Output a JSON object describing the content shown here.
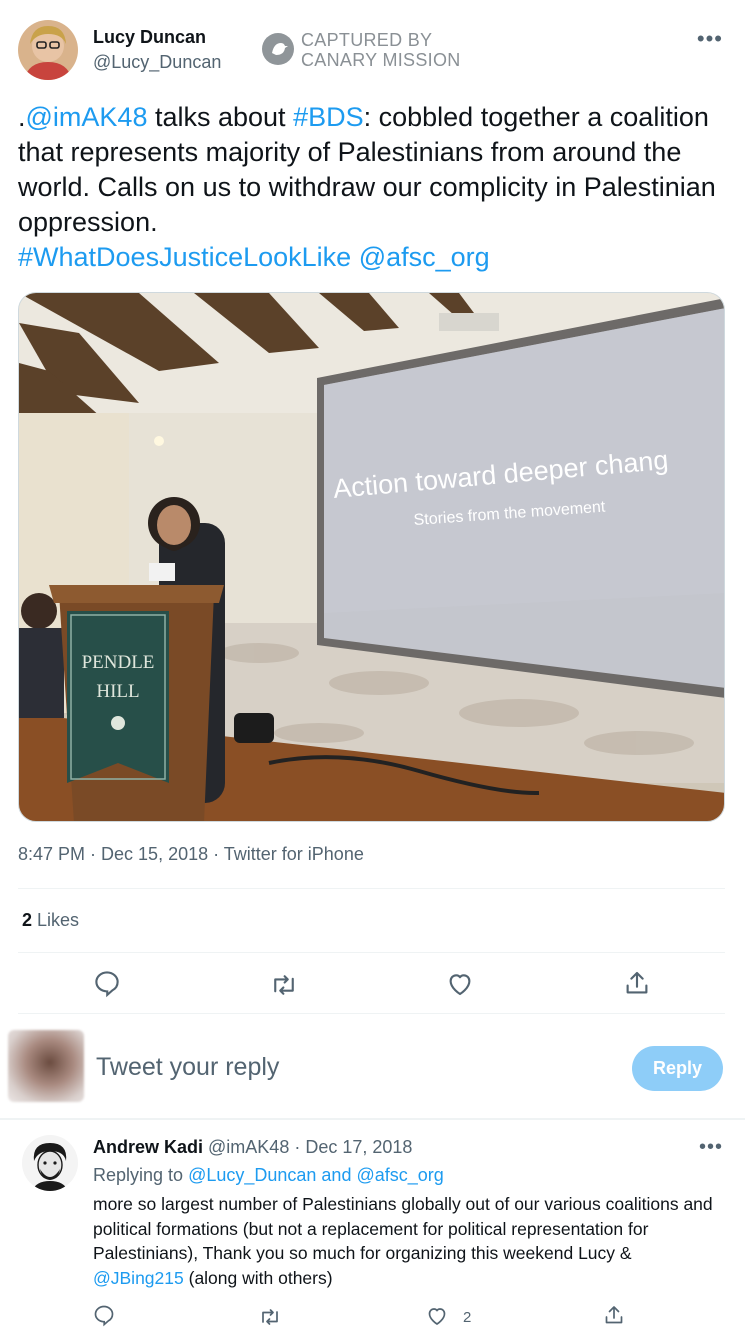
{
  "tweet": {
    "author_name": "Lucy Duncan",
    "author_handle": "@Lucy_Duncan",
    "more_icon": "more-horizontal-icon",
    "stamp": {
      "line1": "CAPTURED BY",
      "line2": "CANARY MISSION"
    },
    "text": {
      "prefix": ".",
      "mention_1": "@imAK48",
      "t1": " talks about ",
      "hashtag_1": "#BDS",
      "t2": ": cobbled together a coalition that represents majority of Palestinians from around the world. Calls on us to withdraw our complicity in Palestinian oppression.",
      "hashtag_2": "#WhatDoesJusticeLookLike",
      "t3": " ",
      "mention_2": "@afsc_org"
    },
    "photo": {
      "slide_title": "Action toward deeper chang",
      "slide_subtitle": "Stories from the movement",
      "banner_line1": "PENDLE",
      "banner_line2": "HILL"
    },
    "meta": "8:47 PM · Dec 15, 2018 · Twitter for iPhone",
    "likes_count": "2",
    "likes_label": " Likes",
    "actions": [
      "reply-icon",
      "retweet-icon",
      "like-icon",
      "share-icon"
    ]
  },
  "composer": {
    "placeholder": "Tweet your reply",
    "reply_button": "Reply"
  },
  "reply": {
    "author_name": "Andrew Kadi",
    "handle_and_date": "@imAK48 · Dec 17, 2018",
    "replying_to_prefix": "Replying to ",
    "replying_to_1": "@Lucy_Duncan",
    "replying_to_and": " and ",
    "replying_to_2": "@afsc_org",
    "body": "more so largest number of Palestinians globally out of our various coalitions and political formations (but not a replacement for political representation for Palestinians), Thank you so much for organizing this weekend Lucy & ",
    "body_mention": "@JBing215",
    "body_end": " (along with others)",
    "like_count": "2"
  },
  "colors": {
    "accent": "#1d9bf0",
    "reply_button": "#8ecdf8",
    "text": "#0f1419",
    "muted": "#536471"
  }
}
